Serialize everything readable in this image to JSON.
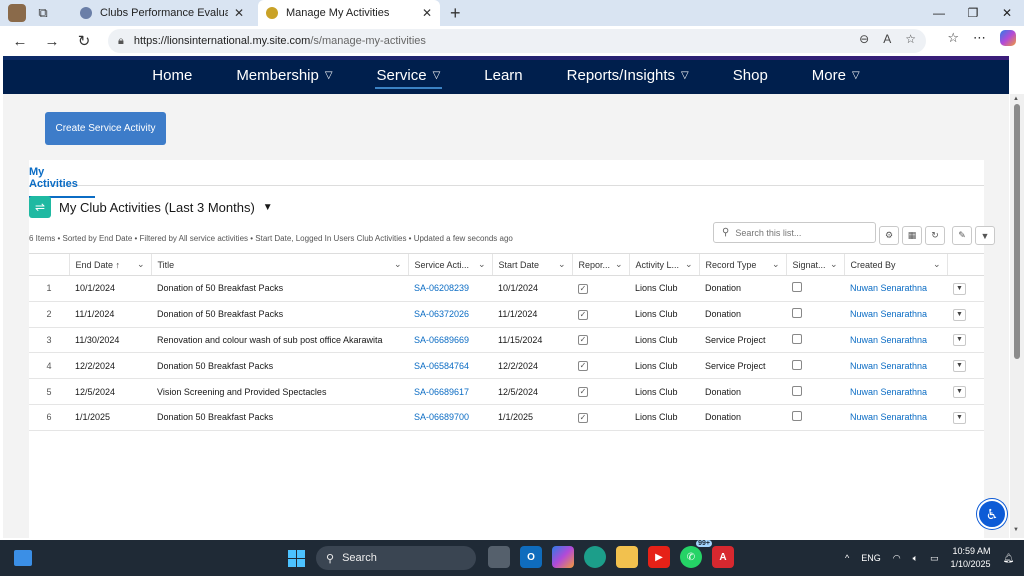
{
  "browser": {
    "tabs": [
      {
        "label": "Clubs Performance Evaluation Sys",
        "active": false
      },
      {
        "label": "Manage My Activities",
        "active": true
      }
    ],
    "url_host": "https://lionsinternational.my.site.com",
    "url_path": "/s/manage-my-activities"
  },
  "nav": {
    "items": [
      {
        "label": "Home",
        "dropdown": false
      },
      {
        "label": "Membership",
        "dropdown": true
      },
      {
        "label": "Service",
        "dropdown": true,
        "active": true
      },
      {
        "label": "Learn",
        "dropdown": false
      },
      {
        "label": "Reports/Insights",
        "dropdown": true
      },
      {
        "label": "Shop",
        "dropdown": false
      },
      {
        "label": "More",
        "dropdown": true
      }
    ]
  },
  "page": {
    "create_button": "Create Service Activity",
    "tab_label": "My Activities",
    "list_title": "My Club Activities (Last 3 Months)",
    "summary": "6 Items • Sorted by End Date • Filtered by All service activities • Start Date, Logged In Users Club Activities • Updated a few seconds ago",
    "search_placeholder": "Search this list..."
  },
  "table": {
    "columns": [
      "End Date ↑",
      "Title",
      "Service Acti...",
      "Start Date",
      "Repor...",
      "Activity L...",
      "Record Type",
      "Signat...",
      "Created By"
    ],
    "rows": [
      {
        "n": "1",
        "end": "10/1/2024",
        "title": "Donation of 50 Breakfast Packs",
        "sa": "SA-06208239",
        "start": "10/1/2024",
        "reported": true,
        "level": "Lions Club",
        "type": "Donation",
        "signed": false,
        "by": "Nuwan Senarathna"
      },
      {
        "n": "2",
        "end": "11/1/2024",
        "title": "Donation of 50 Breakfast Packs",
        "sa": "SA-06372026",
        "start": "11/1/2024",
        "reported": true,
        "level": "Lions Club",
        "type": "Donation",
        "signed": false,
        "by": "Nuwan Senarathna"
      },
      {
        "n": "3",
        "end": "11/30/2024",
        "title": "Renovation and colour wash of sub post office Akarawita",
        "sa": "SA-06689669",
        "start": "11/15/2024",
        "reported": true,
        "level": "Lions Club",
        "type": "Service Project",
        "signed": false,
        "by": "Nuwan Senarathna"
      },
      {
        "n": "4",
        "end": "12/2/2024",
        "title": "Donation 50 Breakfast Packs",
        "sa": "SA-06584764",
        "start": "12/2/2024",
        "reported": true,
        "level": "Lions Club",
        "type": "Service Project",
        "signed": false,
        "by": "Nuwan Senarathna"
      },
      {
        "n": "5",
        "end": "12/5/2024",
        "title": "Vision Screening and Provided Spectacles",
        "sa": "SA-06689617",
        "start": "12/5/2024",
        "reported": true,
        "level": "Lions Club",
        "type": "Donation",
        "signed": false,
        "by": "Nuwan Senarathna"
      },
      {
        "n": "6",
        "end": "1/1/2025",
        "title": "Donation 50 Breakfast Packs",
        "sa": "SA-06689700",
        "start": "1/1/2025",
        "reported": true,
        "level": "Lions Club",
        "type": "Donation",
        "signed": false,
        "by": "Nuwan Senarathna"
      }
    ]
  },
  "taskbar": {
    "search_label": "Search",
    "badge": "99+",
    "lang": "ENG",
    "time": "10:59 AM",
    "date": "1/10/2025"
  },
  "colors": {
    "nav_bg": "#001f4d",
    "accent": "#3d7cc9",
    "link": "#0b6cc4",
    "list_icon": "#1fb9a2"
  }
}
